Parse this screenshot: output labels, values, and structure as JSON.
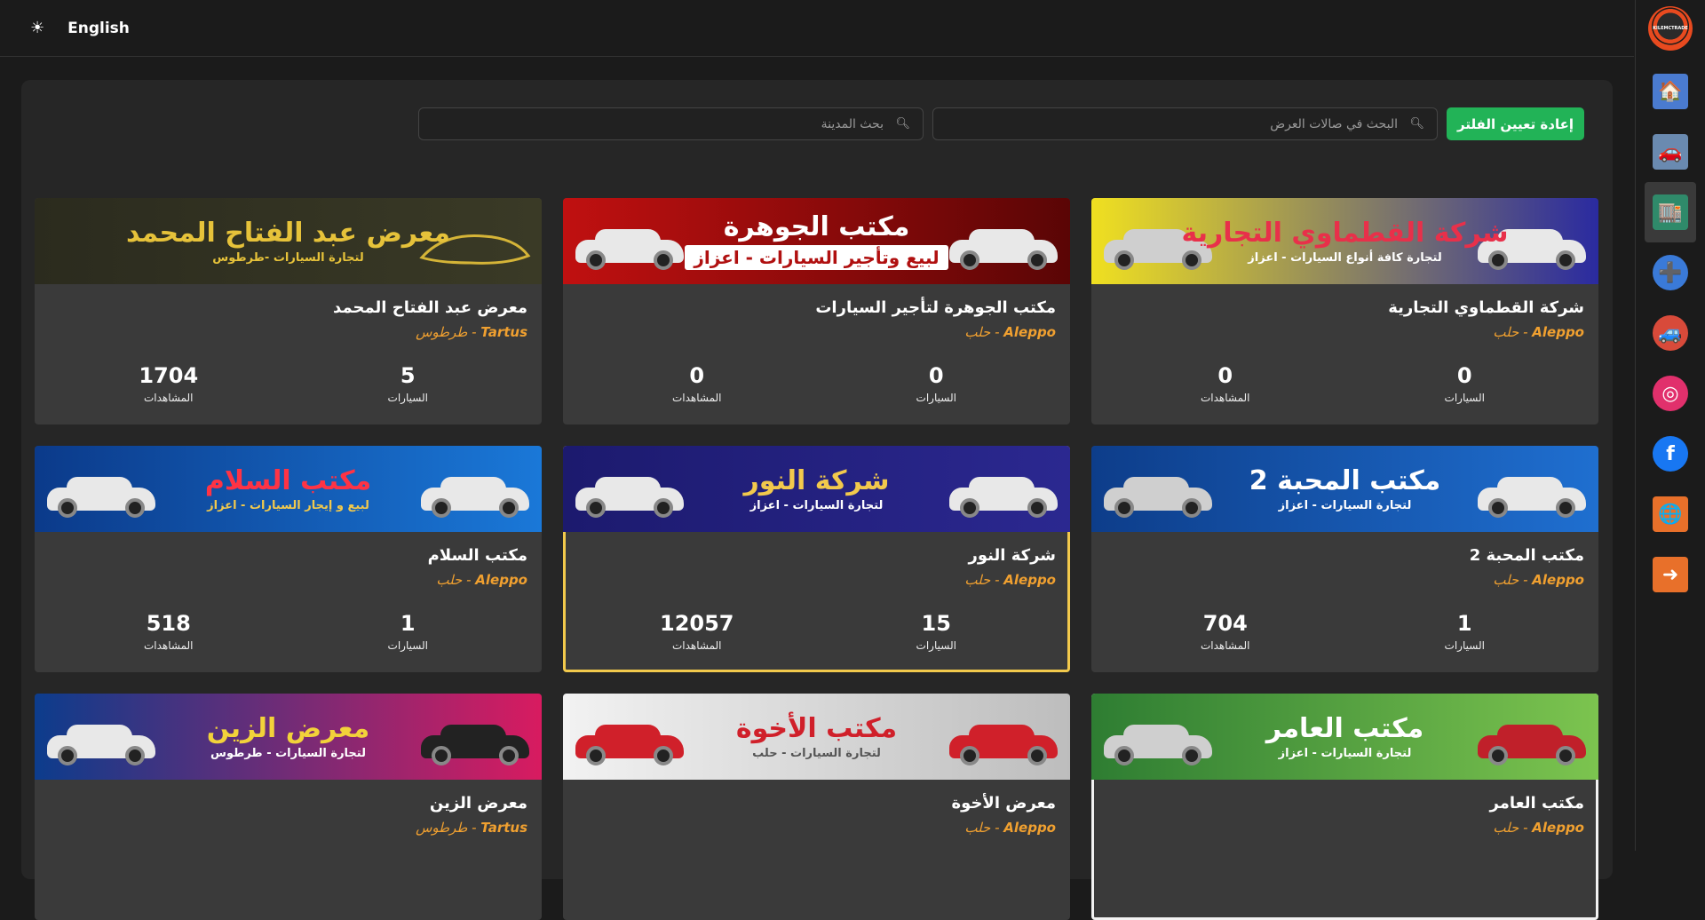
{
  "topbar": {
    "theme_icon": "sun-icon",
    "language": "English"
  },
  "rail": {
    "logo_text": "KILEMCTRADE",
    "items": [
      {
        "name": "showroom-icon",
        "glyph": "🏠"
      },
      {
        "name": "car-icon",
        "glyph": "🚗"
      },
      {
        "name": "showrooms-list-icon",
        "glyph": "🏬"
      },
      {
        "name": "add-car-icon",
        "glyph": "➕"
      },
      {
        "name": "mascot-icon",
        "glyph": "🚙"
      },
      {
        "name": "instagram-icon",
        "glyph": "◎"
      },
      {
        "name": "facebook-icon",
        "glyph": "f"
      },
      {
        "name": "globe-icon",
        "glyph": "🌐"
      },
      {
        "name": "login-icon",
        "glyph": "➜"
      }
    ]
  },
  "filters": {
    "reset_label": "إعادة تعيين الفلتر",
    "search_showrooms_placeholder": "البحث في صالات العرض",
    "search_city_placeholder": "بحث المدينة"
  },
  "cards": [
    {
      "banner_title": "شركة القطماوي التجارية",
      "banner_sub": "لتجارة كافة أنواع السيارات - اعزاز",
      "name": "شركة القطماوي التجارية",
      "city_en": "Aleppo",
      "city_ar": "حلب",
      "cars": "0",
      "views": "0",
      "cars_label": "السيارات",
      "views_label": "المشاهدات",
      "colors": [
        "#f0e020",
        "#2a2aa0"
      ],
      "title_color": "#e8304a",
      "sub_color": "#ffffff"
    },
    {
      "banner_title": "مكتب الجوهرة",
      "banner_sub": "لبيع وتأجير السيارات - اعزاز",
      "name": "مكتب الجوهرة لتأجير السيارات",
      "city_en": "Aleppo",
      "city_ar": "حلب",
      "cars": "0",
      "views": "0",
      "cars_label": "السيارات",
      "views_label": "المشاهدات",
      "colors": [
        "#c01010",
        "#5a0505"
      ],
      "title_color": "#ffffff",
      "sub_color": "#b01010"
    },
    {
      "banner_title": "معرض عبد الفتاح  المحمد",
      "banner_sub": "لتجارة السيارات -طرطوس",
      "name": "معرض عبد الفتاح المحمد",
      "city_en": "Tartus",
      "city_ar": "طرطوس",
      "cars": "5",
      "views": "1704",
      "cars_label": "السيارات",
      "views_label": "المشاهدات",
      "colors": [
        "#2b2b1e",
        "#3a3a26"
      ],
      "title_color": "#e6c23a",
      "sub_color": "#e6c23a"
    },
    {
      "banner_title": "مكتب المحبة 2",
      "banner_sub": "لتجارة السيارات - اعزاز",
      "name": "مكتب المحبة 2",
      "city_en": "Aleppo",
      "city_ar": "حلب",
      "cars": "1",
      "views": "704",
      "cars_label": "السيارات",
      "views_label": "المشاهدات",
      "colors": [
        "#0d3d8a",
        "#1f6fd0"
      ],
      "title_color": "#ffffff",
      "sub_color": "#ffffff"
    },
    {
      "banner_title": "شركة النور",
      "banner_sub": "لتجارة السيارات - اعزاز",
      "name": "شركة النور",
      "city_en": "Aleppo",
      "city_ar": "حلب",
      "cars": "15",
      "views": "12057",
      "cars_label": "السيارات",
      "views_label": "المشاهدات",
      "colors": [
        "#1c1a6e",
        "#2b2890"
      ],
      "title_color": "#f2c94c",
      "sub_color": "#ffffff"
    },
    {
      "banner_title": "مكتب السلام",
      "banner_sub": "لبيع و إيجار السيارات - اعزاز",
      "name": "مكتب السلام",
      "city_en": "Aleppo",
      "city_ar": "حلب",
      "cars": "1",
      "views": "518",
      "cars_label": "السيارات",
      "views_label": "المشاهدات",
      "colors": [
        "#0b3a8a",
        "#1a78d8"
      ],
      "title_color": "#ff3344",
      "sub_color": "#f2c94c"
    },
    {
      "banner_title": "مكتب العامر",
      "banner_sub": "لتجارة السيارات - اعزاز",
      "name": "مكتب العامر",
      "city_en": "Aleppo",
      "city_ar": "حلب",
      "cars": "",
      "views": "",
      "cars_label": "",
      "views_label": "",
      "colors": [
        "#2e7d32",
        "#7cc44f"
      ],
      "title_color": "#ffffff",
      "sub_color": "#ffffff"
    },
    {
      "banner_title": "مكتب الأخوة",
      "banner_sub": "لتجارة السيارات - حلب",
      "name": "معرض الأخوة",
      "city_en": "Aleppo",
      "city_ar": "حلب",
      "cars": "",
      "views": "",
      "cars_label": "",
      "views_label": "",
      "colors": [
        "#f2f2f2",
        "#bdbdbd"
      ],
      "title_color": "#d0202a",
      "sub_color": "#555555"
    },
    {
      "banner_title": "معرض الزين",
      "banner_sub": "لتجارة السيارات - طرطوس",
      "name": "معرض الزين",
      "city_en": "Tartus",
      "city_ar": "طرطوس",
      "cars": "",
      "views": "",
      "cars_label": "",
      "views_label": "",
      "colors": [
        "#0c3c8c",
        "#d81b60"
      ],
      "title_color": "#f2d23a",
      "sub_color": "#ffffff"
    }
  ]
}
